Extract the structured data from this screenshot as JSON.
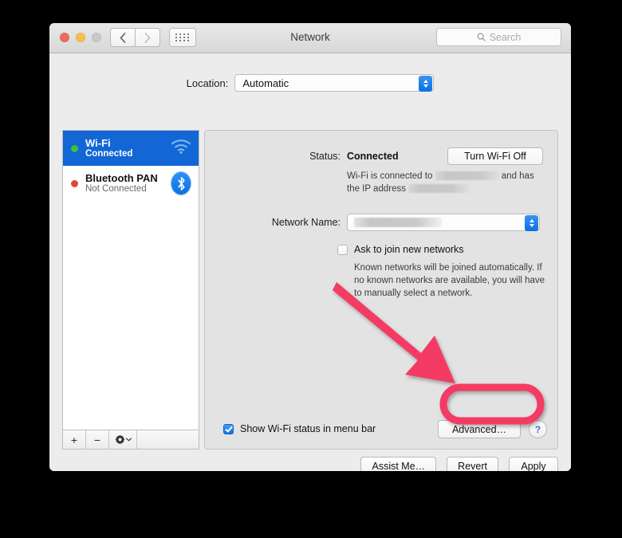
{
  "window": {
    "title": "Network",
    "traffic_lights": [
      "close",
      "minimize",
      "zoom"
    ],
    "nav_back_icon": "chevron-left-icon",
    "nav_forward_icon": "chevron-right-icon",
    "grid_icon": "show-all-grid-icon",
    "search": {
      "placeholder": "Search",
      "icon": "search-icon"
    }
  },
  "location": {
    "label": "Location:",
    "value": "Automatic"
  },
  "sidebar": {
    "services": [
      {
        "name": "Wi-Fi",
        "state": "Connected",
        "dot_color": "#3cc13b",
        "icon": "wifi-icon",
        "selected": true
      },
      {
        "name": "Bluetooth PAN",
        "state": "Not Connected",
        "dot_color": "#e8433a",
        "icon": "bluetooth-icon",
        "selected": false
      }
    ],
    "toolbar": {
      "add_label": "+",
      "remove_label": "−",
      "action_icon": "gear-icon",
      "action_chevron": "chevron-down-icon"
    }
  },
  "main": {
    "status": {
      "label": "Status:",
      "value": "Connected",
      "toggle_button": "Turn Wi-Fi Off",
      "description_prefix": "Wi-Fi is connected to",
      "description_middle": "and has the IP",
      "description_suffix": "address",
      "ssid_redacted": true,
      "ip_redacted": true
    },
    "network_name": {
      "label": "Network Name:",
      "value_redacted": true
    },
    "ask_to_join": {
      "label": "Ask to join new networks",
      "checked": false,
      "description": "Known networks will be joined automatically. If no known networks are available, you will have to manually select a network."
    },
    "show_status": {
      "label": "Show Wi-Fi status in menu bar",
      "checked": true
    },
    "advanced_button": "Advanced…",
    "help_button": "?"
  },
  "footer": {
    "buttons": [
      "Assist Me…",
      "Revert",
      "Apply"
    ]
  },
  "annotations": {
    "accent_color": "#f43a63",
    "arrow": "red-arrow-pointing-to-advanced-button",
    "highlight": "pink-ellipse-around-advanced-button"
  }
}
